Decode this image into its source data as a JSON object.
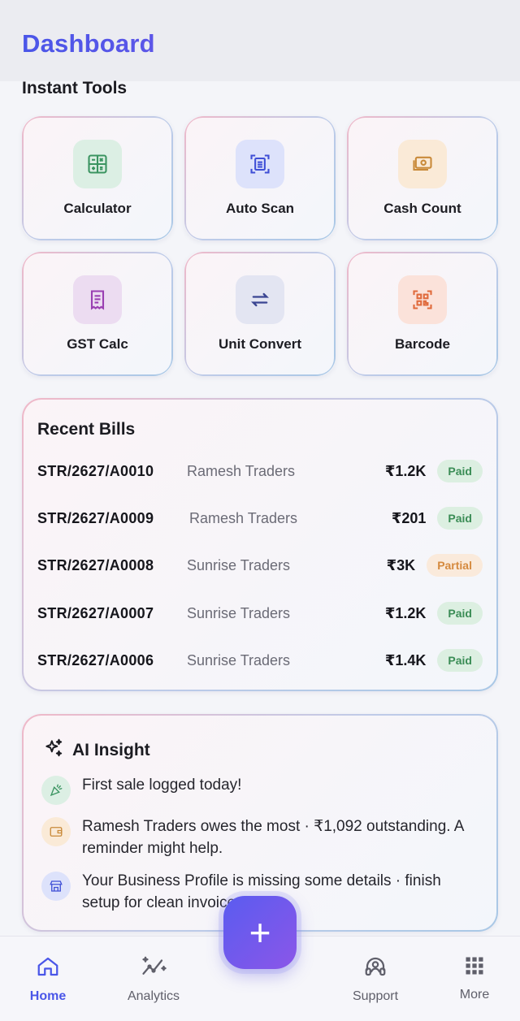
{
  "header": {
    "title": "Dashboard"
  },
  "tools": {
    "title": "Instant Tools",
    "items": [
      {
        "label": "Calculator",
        "icon": "calculator-icon",
        "bg": "#dcefe4",
        "color": "#3b9461"
      },
      {
        "label": "Auto Scan",
        "icon": "scan-icon",
        "bg": "#dde2fb",
        "color": "#3f4fd6"
      },
      {
        "label": "Cash Count",
        "icon": "cash-icon",
        "bg": "#faead7",
        "color": "#c98a3a"
      },
      {
        "label": "GST Calc",
        "icon": "receipt-icon",
        "bg": "#ecdcf1",
        "color": "#9a3fb2"
      },
      {
        "label": "Unit Convert",
        "icon": "swap-icon",
        "bg": "#e3e5f2",
        "color": "#3a4592"
      },
      {
        "label": "Barcode",
        "icon": "qr-code-icon",
        "bg": "#fbe2da",
        "color": "#e06a3c"
      }
    ]
  },
  "bills": {
    "title": "Recent Bills",
    "rows": [
      {
        "id": "STR/2627/A0010",
        "party": "Ramesh Traders",
        "amount": "₹1.2K",
        "status": "Paid"
      },
      {
        "id": "STR/2627/A0009",
        "party": "Ramesh Traders",
        "amount": "₹201",
        "status": "Paid"
      },
      {
        "id": "STR/2627/A0008",
        "party": "Sunrise Traders",
        "amount": "₹3K",
        "status": "Partial"
      },
      {
        "id": "STR/2627/A0007",
        "party": "Sunrise Traders",
        "amount": "₹1.2K",
        "status": "Paid"
      },
      {
        "id": "STR/2627/A0006",
        "party": "Sunrise Traders",
        "amount": "₹1.4K",
        "status": "Paid"
      }
    ]
  },
  "ai": {
    "title": "AI Insight",
    "insights": [
      {
        "icon": "party-popper-icon",
        "text": "First sale logged today!"
      },
      {
        "icon": "wallet-icon",
        "text": "Ramesh Traders owes the most · ₹1,092 outstanding. A reminder might help."
      },
      {
        "icon": "store-icon",
        "text": "Your Business Profile is missing some details · finish setup for clean invoices."
      }
    ]
  },
  "nav": {
    "items": [
      {
        "label": "Home",
        "icon": "home-icon",
        "active": true
      },
      {
        "label": "Analytics",
        "icon": "analytics-icon",
        "active": false
      },
      {
        "label": "Support",
        "icon": "headset-icon",
        "active": false
      },
      {
        "label": "More",
        "icon": "grid-icon",
        "active": false
      }
    ],
    "fab": "+"
  },
  "colors": {
    "accent": "#4a56e8",
    "accent2": "#8b55e6",
    "paid": "#3b8d56",
    "partial": "#d58a3f"
  }
}
